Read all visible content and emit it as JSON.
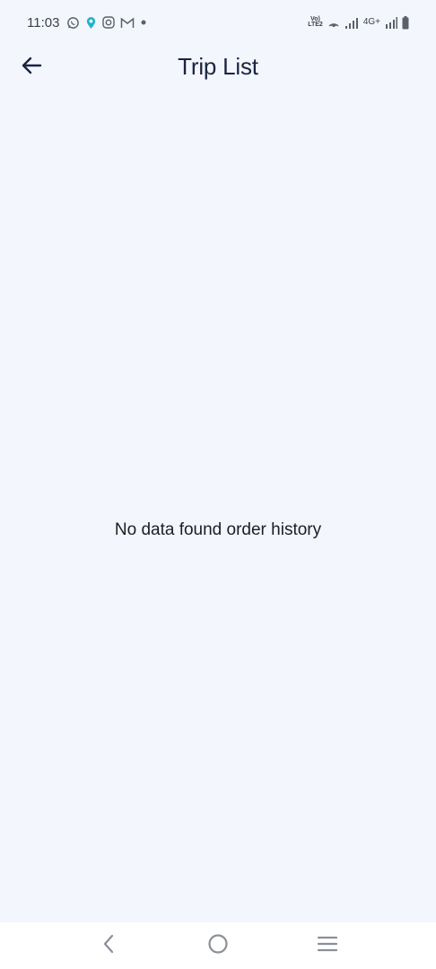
{
  "status_bar": {
    "time": "11:03",
    "left_icons": [
      "whatsapp-icon",
      "location-pin-icon",
      "instagram-icon",
      "gmail-icon",
      "dot-icon"
    ],
    "network_label_top": "Vo)",
    "network_label_bottom": "LTE2",
    "network_type": "4G+",
    "right_icons": [
      "hotspot-icon",
      "signal-icon",
      "signal-icon-2",
      "battery-icon"
    ]
  },
  "header": {
    "title": "Trip List",
    "back_icon": "arrow-left-icon"
  },
  "main": {
    "empty_message": "No data found order history"
  },
  "nav_bar": {
    "items": [
      "back-nav-icon",
      "home-nav-icon",
      "menu-nav-icon"
    ]
  },
  "colors": {
    "background": "#f3f6fd",
    "title": "#1b2440",
    "nav_background": "#ffffff",
    "location_pin": "#23b3c9"
  }
}
